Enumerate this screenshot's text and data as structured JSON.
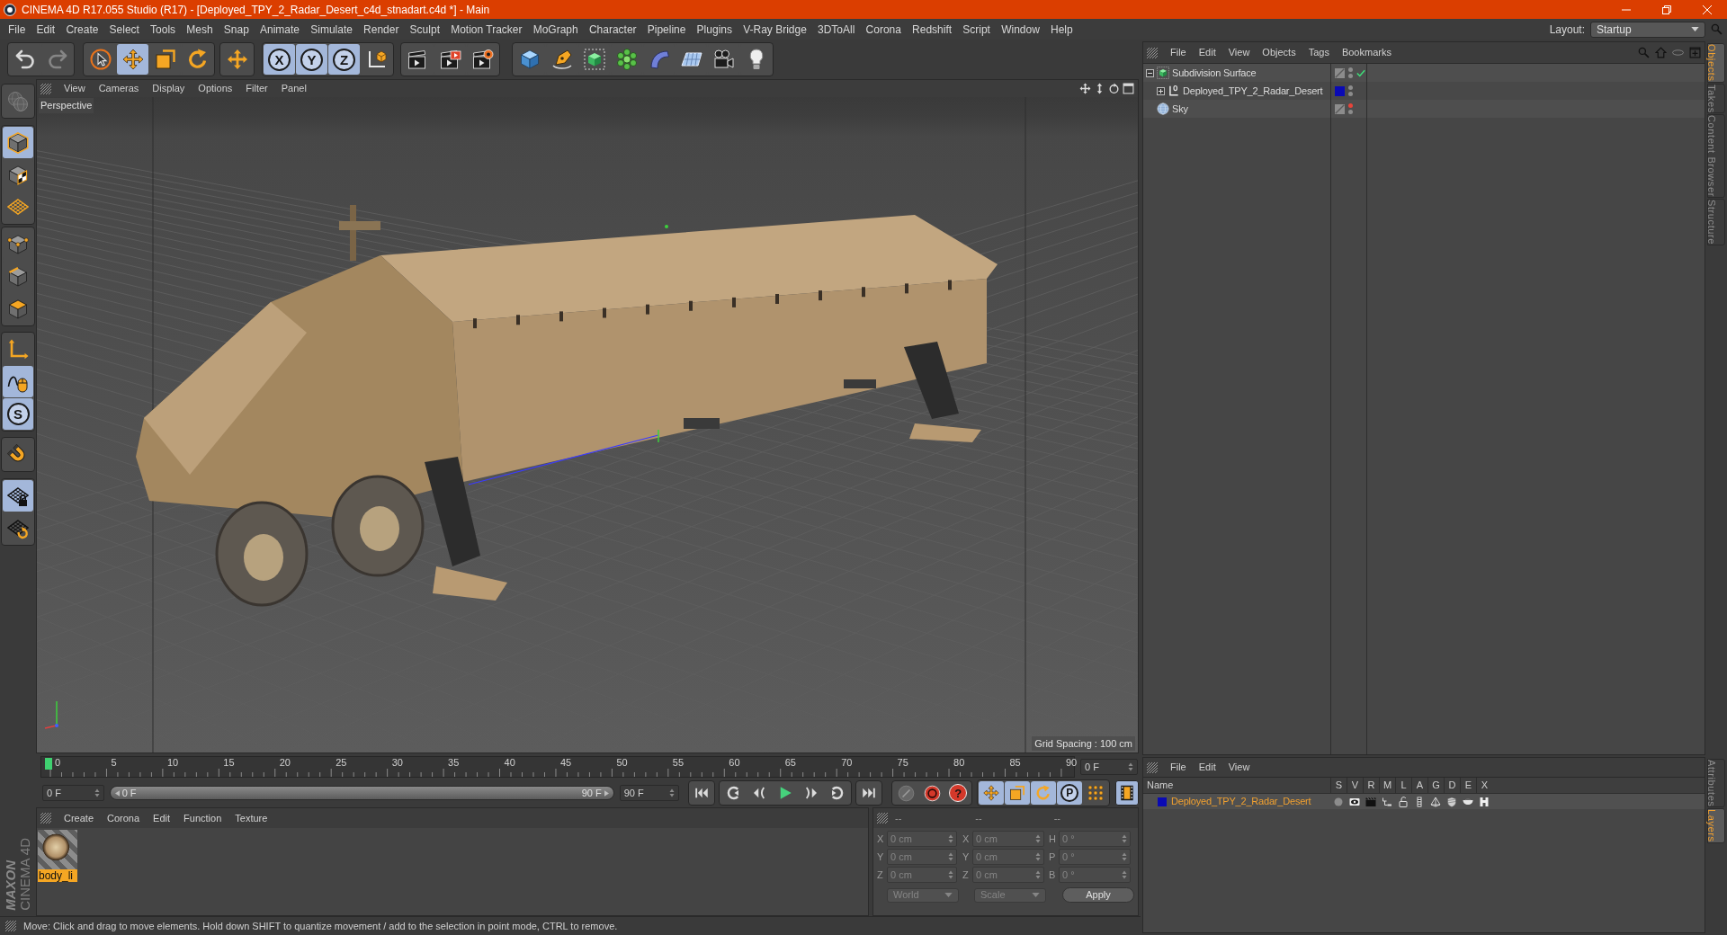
{
  "window": {
    "title": "CINEMA 4D R17.055 Studio (R17) - [Deployed_TPY_2_Radar_Desert_c4d_stnadart.c4d *] - Main"
  },
  "menu_bar": {
    "items": [
      "File",
      "Edit",
      "Create",
      "Select",
      "Tools",
      "Mesh",
      "Snap",
      "Animate",
      "Simulate",
      "Render",
      "Sculpt",
      "Motion Tracker",
      "MoGraph",
      "Character",
      "Pipeline",
      "Plugins",
      "V-Ray Bridge",
      "3DToAll",
      "Corona",
      "Redshift",
      "Script",
      "Window",
      "Help"
    ],
    "layout_label": "Layout:",
    "layout_value": "Startup"
  },
  "toolbar": {
    "groups": [
      [
        {
          "selected": false,
          "disabled": false
        },
        {
          "selected": false,
          "disabled": true
        }
      ],
      [
        {
          "selected": false,
          "disabled": false
        },
        {
          "selected": true,
          "disabled": false
        },
        {
          "selected": false,
          "disabled": false
        },
        {
          "selected": false,
          "disabled": false
        }
      ],
      [
        {
          "selected": false,
          "disabled": false
        }
      ],
      [
        {
          "label": "X",
          "selected": true,
          "disabled": false
        },
        {
          "label": "Y",
          "selected": true,
          "disabled": false
        },
        {
          "label": "Z",
          "selected": true,
          "disabled": false
        },
        {
          "selected": false,
          "disabled": false
        }
      ],
      [
        {
          "selected": false,
          "disabled": false
        },
        {
          "selected": false,
          "disabled": false
        },
        {
          "selected": false,
          "disabled": false
        }
      ],
      [
        {
          "selected": false,
          "disabled": false
        },
        {
          "selected": false,
          "disabled": false
        },
        {
          "selected": false,
          "disabled": false
        },
        {
          "selected": false,
          "disabled": false
        },
        {
          "selected": false,
          "disabled": false
        },
        {
          "selected": false,
          "disabled": false
        },
        {
          "selected": false,
          "disabled": false
        },
        {
          "selected": false,
          "disabled": false
        }
      ]
    ]
  },
  "mode_toolbar": {
    "groups": [
      [
        {
          "selected": false,
          "disabled": true
        }
      ],
      [
        {
          "selected": true,
          "disabled": false
        },
        {
          "selected": false,
          "disabled": false
        },
        {
          "selected": false,
          "disabled": false
        }
      ],
      [
        {
          "selected": false,
          "disabled": false
        },
        {
          "selected": false,
          "disabled": false
        },
        {
          "selected": false,
          "disabled": false
        }
      ],
      [
        {
          "selected": false,
          "disabled": false
        },
        {
          "selected": true,
          "disabled": false
        },
        {
          "label": "S",
          "selected": true,
          "disabled": false
        }
      ],
      [
        {
          "selected": false,
          "disabled": false
        }
      ],
      [
        {
          "selected": true,
          "disabled": false
        },
        {
          "selected": false,
          "disabled": false
        }
      ]
    ]
  },
  "viewport": {
    "menu": [
      "View",
      "Cameras",
      "Display",
      "Options",
      "Filter",
      "Panel"
    ],
    "camera": "Perspective",
    "grid_spacing": "Grid Spacing : 100 cm"
  },
  "timeline": {
    "ticks": [
      "0",
      "5",
      "10",
      "15",
      "20",
      "25",
      "30",
      "35",
      "40",
      "45",
      "50",
      "55",
      "60",
      "65",
      "70",
      "75",
      "80",
      "85",
      "90"
    ],
    "playhead": {
      "level": 0
    },
    "current_frame": "0 F",
    "start_frame": "0 F",
    "range_slider": {
      "level": 1,
      "start_label": "0 F",
      "end_label": "90 F"
    },
    "end_frame": "90 F",
    "record_buttons": [
      {
        "disabled": true
      },
      {
        "disabled": false
      },
      {
        "label": "?",
        "disabled": false
      }
    ],
    "key_buttons": [
      {
        "selected": true
      },
      {
        "selected": true
      },
      {
        "selected": true
      },
      {
        "label": "P",
        "selected": true
      },
      {
        "selected": false
      }
    ],
    "timeline_button": {
      "selected": true
    }
  },
  "material_manager": {
    "menu": [
      "Create",
      "Corona",
      "Edit",
      "Function",
      "Texture"
    ],
    "materials": [
      {
        "name": "body_li",
        "selected": true
      }
    ]
  },
  "coordinates": {
    "headers": [
      "--",
      "--",
      "--"
    ],
    "rows": [
      {
        "cells": [
          {
            "label": "X",
            "value": "0 cm"
          },
          {
            "label": "X",
            "value": "0 cm"
          },
          {
            "label": "H",
            "value": "0 °"
          }
        ]
      },
      {
        "cells": [
          {
            "label": "Y",
            "value": "0 cm"
          },
          {
            "label": "Y",
            "value": "0 cm"
          },
          {
            "label": "P",
            "value": "0 °"
          }
        ]
      },
      {
        "cells": [
          {
            "label": "Z",
            "value": "0 cm"
          },
          {
            "label": "Z",
            "value": "0 cm"
          },
          {
            "label": "B",
            "value": "0 °"
          }
        ]
      }
    ],
    "coordinate_system": "World",
    "size_mode": "Scale",
    "apply": "Apply"
  },
  "object_manager": {
    "menu": [
      "File",
      "Edit",
      "View",
      "Objects",
      "Tags",
      "Bookmarks"
    ],
    "objects": [
      {
        "kind": "subdivision",
        "name": "Subdivision Surface",
        "expanded": true,
        "enabled": true,
        "editor_hidden": false,
        "render_hidden": false,
        "children": [
          {
            "kind": "null",
            "name": "Deployed_TPY_2_Radar_Desert",
            "expanded": false,
            "color": "#0a0ab4",
            "editor_hidden": false,
            "render_hidden": false
          }
        ]
      },
      {
        "kind": "sky",
        "name": "Sky",
        "editor_hidden": true,
        "render_hidden": false
      }
    ]
  },
  "layer_manager": {
    "menu": [
      "File",
      "Edit",
      "View"
    ],
    "columns": [
      "Name",
      "S",
      "V",
      "R",
      "M",
      "L",
      "A",
      "G",
      "D",
      "E",
      "X"
    ],
    "layers": [
      {
        "name": "Deployed_TPY_2_Radar_Desert",
        "color": "#0a0ab4",
        "selected": true
      }
    ]
  },
  "side_tabs": {
    "top": [
      {
        "label": "Objects",
        "selected": true
      },
      {
        "label": "Takes",
        "selected": false
      },
      {
        "label": "Content Browser",
        "selected": false
      },
      {
        "label": "Structure",
        "selected": false
      }
    ],
    "bottom": [
      {
        "label": "Attributes",
        "selected": false
      },
      {
        "label": "Layers",
        "selected": true
      }
    ]
  },
  "logo": {
    "line_1": "MAXON",
    "line_2": "CINEMA 4D"
  },
  "status_bar": {
    "text": "Move: Click and drag to move elements. Hold down SHIFT to quantize movement / add to the selection in point mode, CTRL to remove."
  }
}
